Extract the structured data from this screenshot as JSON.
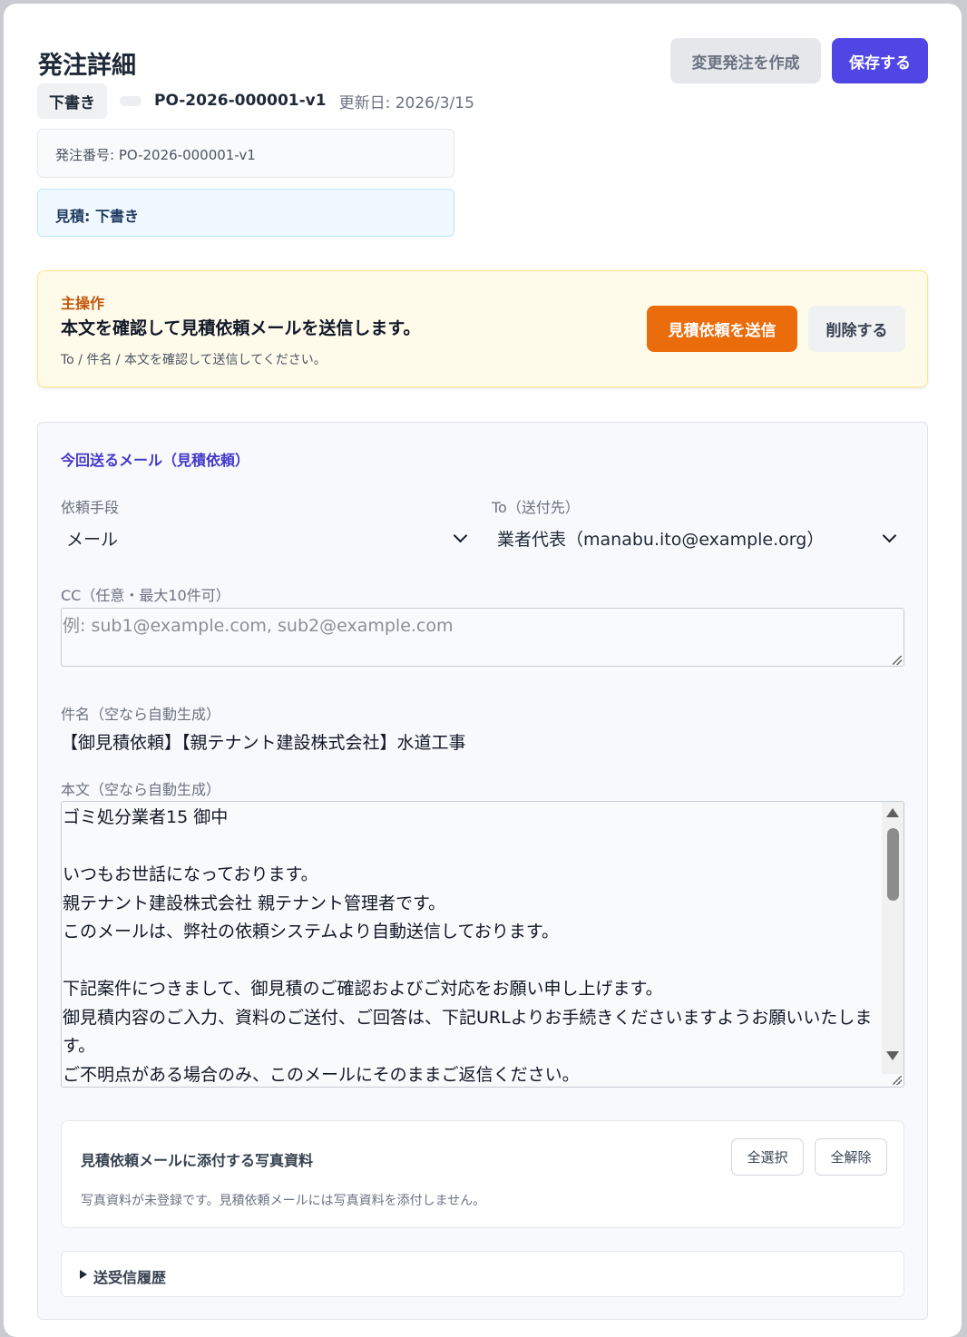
{
  "header": {
    "title": "発注詳細",
    "change_order_label": "変更発注を作成",
    "save_label": "保存する"
  },
  "meta": {
    "status_badge": "下書き",
    "po_number": "PO-2026-000001-v1",
    "updated": "更新日: 2026/3/15"
  },
  "info": {
    "order_number": "発注番号: PO-2026-000001-v1",
    "quote_status": "見積: 下書き"
  },
  "primary_action": {
    "label": "主操作",
    "title": "本文を確認して見積依頼メールを送信します。",
    "sub": "To / 件名 / 本文を確認して送信してください。",
    "send_label": "見積依頼を送信",
    "delete_label": "削除する"
  },
  "mail": {
    "section_title": "今回送るメール（見積依頼）",
    "method_label": "依頼手段",
    "method_value": "メール",
    "to_label": "To（送付先）",
    "to_value": "業者代表（manabu.ito@example.org）",
    "cc_label": "CC（任意・最大10件可）",
    "cc_placeholder": "例: sub1@example.com, sub2@example.com",
    "subject_label": "件名（空なら自動生成）",
    "subject_value": "【御見積依頼】【親テナント建設株式会社】水道工事",
    "body_label": "本文（空なら自動生成）",
    "body_text": "ゴミ処分業者15 御中\n\nいつもお世話になっております。\n親テナント建設株式会社 親テナント管理者です。\nこのメールは、弊社の依頼システムより自動送信しております。\n\n下記案件につきまして、御見積のご確認およびご対応をお願い申し上げます。\n御見積内容のご入力、資料のご送付、ご回答は、下記URLよりお手続きくださいますようお願いいたしま\nす。\nご不明点がある場合のみ、このメールにそのままご返信ください。"
  },
  "photos": {
    "title": "見積依頼メールに添付する写真資料",
    "note": "写真資料が未登録です。見積依頼メールには写真資料を添付しません。",
    "select_all_label": "全選択",
    "clear_all_label": "全解除"
  },
  "history": {
    "label": "送受信履歴"
  }
}
